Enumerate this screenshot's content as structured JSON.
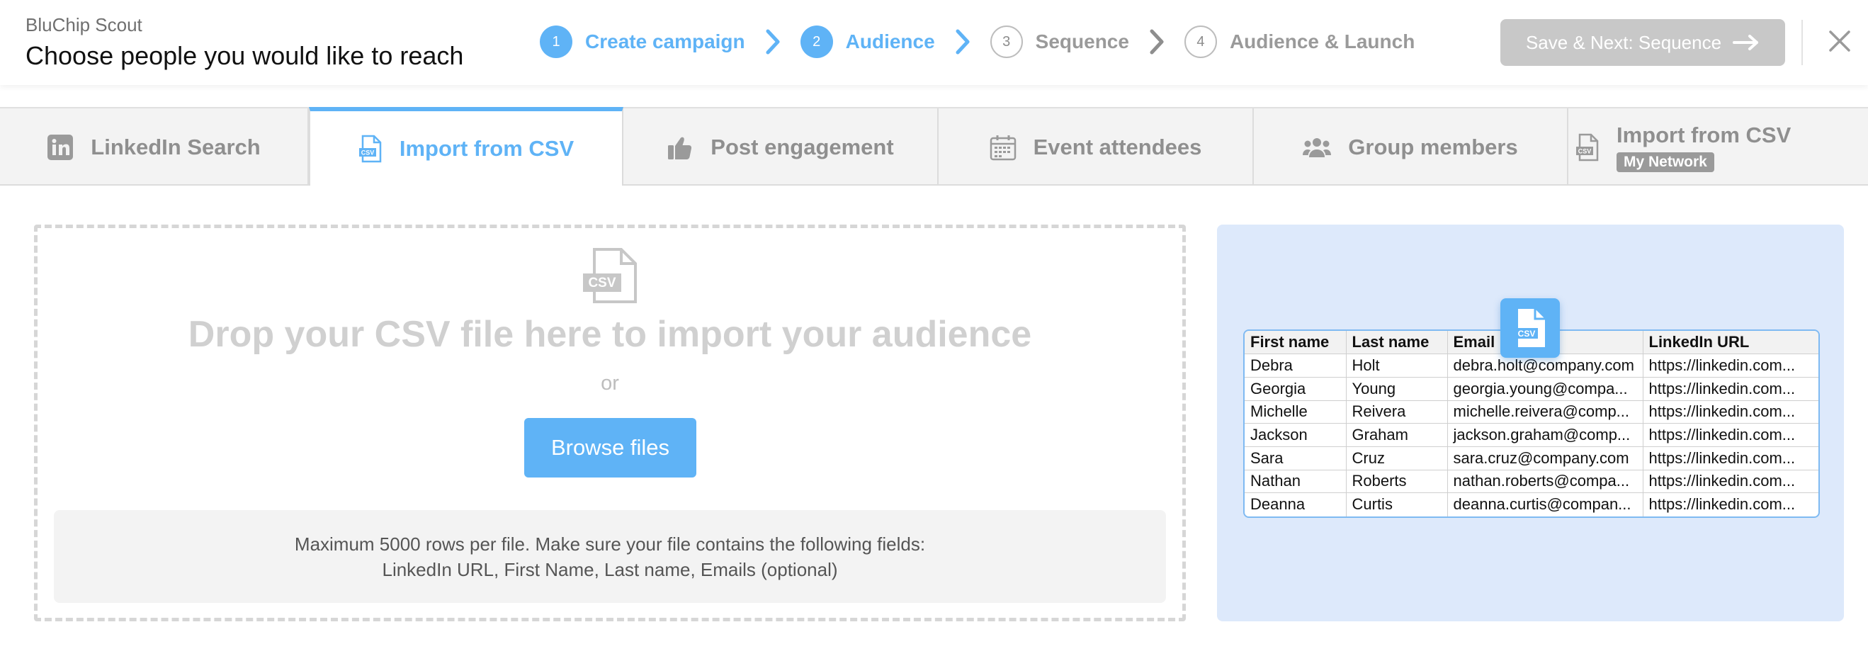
{
  "header": {
    "app_name": "BluChip Scout",
    "title": "Choose people you would like to reach",
    "steps": [
      {
        "num": "1",
        "label": "Create campaign",
        "state": "active"
      },
      {
        "num": "2",
        "label": "Audience",
        "state": "active"
      },
      {
        "num": "3",
        "label": "Sequence",
        "state": "inactive"
      },
      {
        "num": "4",
        "label": "Audience & Launch",
        "state": "inactive"
      }
    ],
    "save_label": "Save & Next: Sequence",
    "accent_color": "#5fb3f6"
  },
  "tabs": [
    {
      "label": "LinkedIn Search",
      "icon": "linkedin-icon"
    },
    {
      "label": "Import from CSV",
      "icon": "csv-file-icon",
      "active": true
    },
    {
      "label": "Post engagement",
      "icon": "thumbs-up-icon"
    },
    {
      "label": "Event attendees",
      "icon": "calendar-icon"
    },
    {
      "label": "Group members",
      "icon": "group-icon"
    },
    {
      "label": "Import from CSV",
      "icon": "csv-file-icon",
      "badge": "My Network"
    }
  ],
  "dropzone": {
    "title": "Drop your CSV file here to import your audience",
    "or": "or",
    "browse_label": "Browse files",
    "info_line1": "Maximum 5000 rows per file. Make sure your file contains the following fields:",
    "info_line2": "LinkedIn URL, First Name, Last name, Emails (optional)"
  },
  "preview": {
    "columns": [
      "First name",
      "Last name",
      "Email",
      "LinkedIn URL"
    ],
    "rows": [
      [
        "Debra",
        "Holt",
        "debra.holt@company.com",
        "https://linkedin.com..."
      ],
      [
        "Georgia",
        "Young",
        "georgia.young@compa...",
        "https://linkedin.com..."
      ],
      [
        "Michelle",
        "Reivera",
        "michelle.reivera@comp...",
        "https://linkedin.com..."
      ],
      [
        "Jackson",
        "Graham",
        "jackson.graham@comp...",
        "https://linkedin.com..."
      ],
      [
        "Sara",
        "Cruz",
        "sara.cruz@company.com",
        "https://linkedin.com..."
      ],
      [
        "Nathan",
        "Roberts",
        "nathan.roberts@compa...",
        "https://linkedin.com..."
      ],
      [
        "Deanna",
        "Curtis",
        "deanna.curtis@compan...",
        "https://linkedin.com..."
      ]
    ]
  }
}
